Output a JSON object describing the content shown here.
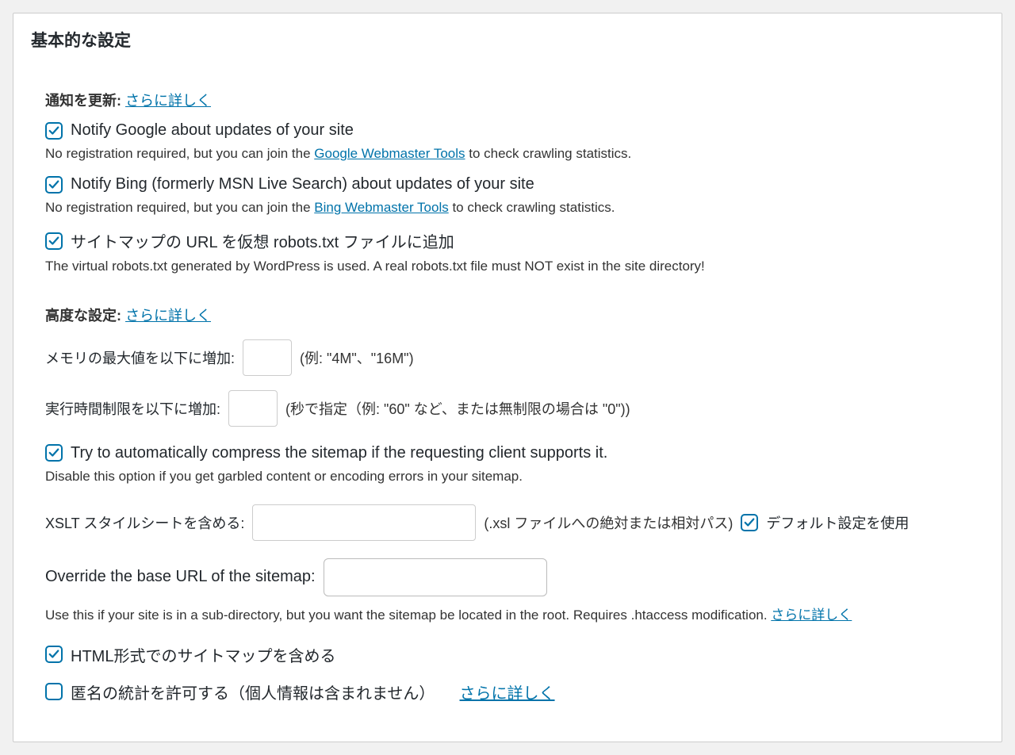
{
  "panel": {
    "title": "基本的な設定"
  },
  "notif": {
    "heading": "通知を更新:",
    "more_link": "さらに詳しく",
    "google": {
      "label": "Notify Google about updates of your site",
      "checked": true,
      "desc_pre": "No registration required, but you can join the ",
      "desc_link": "Google Webmaster Tools",
      "desc_post": " to check crawling statistics."
    },
    "bing": {
      "label": "Notify Bing (formerly MSN Live Search) about updates of your site",
      "checked": true,
      "desc_pre": "No registration required, but you can join the ",
      "desc_link": "Bing Webmaster Tools",
      "desc_post": " to check crawling statistics."
    },
    "robots": {
      "label": "サイトマップの URL を仮想 robots.txt ファイルに追加",
      "checked": true,
      "desc": "The virtual robots.txt generated by WordPress is used. A real robots.txt file must NOT exist in the site directory!"
    }
  },
  "adv": {
    "heading": "高度な設定:",
    "more_link": "さらに詳しく",
    "memory": {
      "label": "メモリの最大値を以下に増加:",
      "value": "",
      "hint": "(例: \"4M\"、\"16M\")"
    },
    "exec": {
      "label": "実行時間制限を以下に増加:",
      "value": "",
      "hint": "(秒で指定（例: \"60\" など、または無制限の場合は \"0\"))"
    },
    "compress": {
      "label": "Try to automatically compress the sitemap if the requesting client supports it.",
      "checked": true,
      "desc": "Disable this option if you get garbled content or encoding errors in your sitemap."
    },
    "xslt": {
      "label": "XSLT スタイルシートを含める:",
      "value": "",
      "hint": "(.xsl ファイルへの絶対または相対パス)",
      "default_label": "デフォルト設定を使用",
      "default_checked": true
    },
    "baseurl": {
      "label": "Override the base URL of the sitemap:",
      "value": "",
      "desc": "Use this if your site is in a sub-directory, but you want the sitemap be located in the root. Requires .htaccess modification. ",
      "more_link": "さらに詳しく"
    },
    "html": {
      "label": "HTML形式でのサイトマップを含める",
      "checked": true
    },
    "anon": {
      "label": "匿名の統計を許可する（個人情報は含まれません）",
      "checked": false,
      "more_link": "さらに詳しく"
    }
  }
}
